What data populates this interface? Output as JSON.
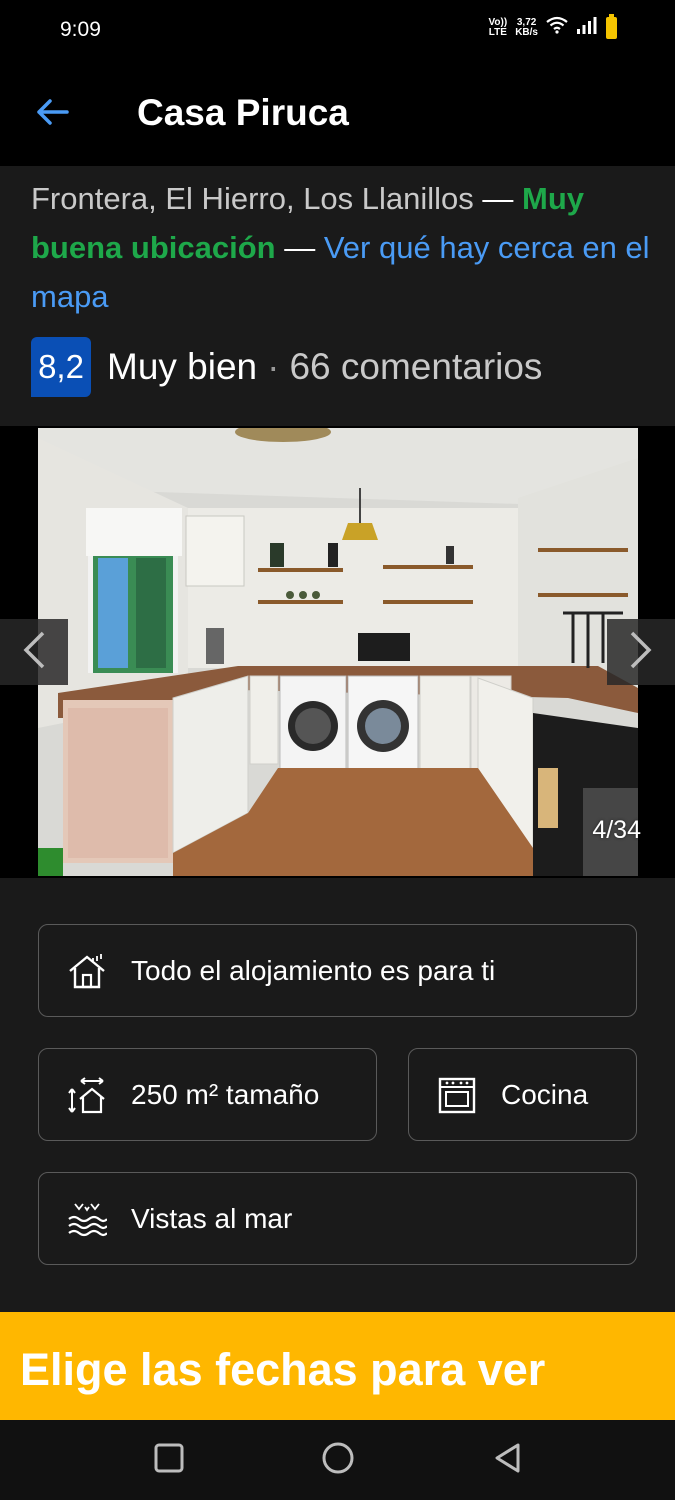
{
  "status": {
    "time": "9:09",
    "volte_top": "Vo))",
    "volte_bottom": "LTE",
    "speed_value": "3,72",
    "speed_unit": "KB/s"
  },
  "header": {
    "title": "Casa Piruca"
  },
  "location": {
    "address": "Frontera, El Hierro, Los Llanillos",
    "dash": " — ",
    "highlight": "Muy buena ubicación",
    "map_link": "Ver qué hay cerca en el mapa"
  },
  "rating": {
    "score": "8,2",
    "label": "Muy bien",
    "separator": "·",
    "reviews": "66 comentarios"
  },
  "gallery": {
    "counter": "4/34"
  },
  "features": [
    {
      "label": "Todo el alojamiento es para ti",
      "icon": "house-icon"
    },
    {
      "label": "250 m² tamaño",
      "icon": "size-icon"
    },
    {
      "label": "Cocina",
      "icon": "oven-icon"
    },
    {
      "label": "Vistas al mar",
      "icon": "sea-view-icon"
    }
  ],
  "cta": {
    "label": "Elige las fechas para ver"
  },
  "colors": {
    "accent_blue": "#0a4fb5",
    "link_blue": "#4a9bf5",
    "location_green": "#1ea84a",
    "cta_yellow": "#ffb700"
  }
}
